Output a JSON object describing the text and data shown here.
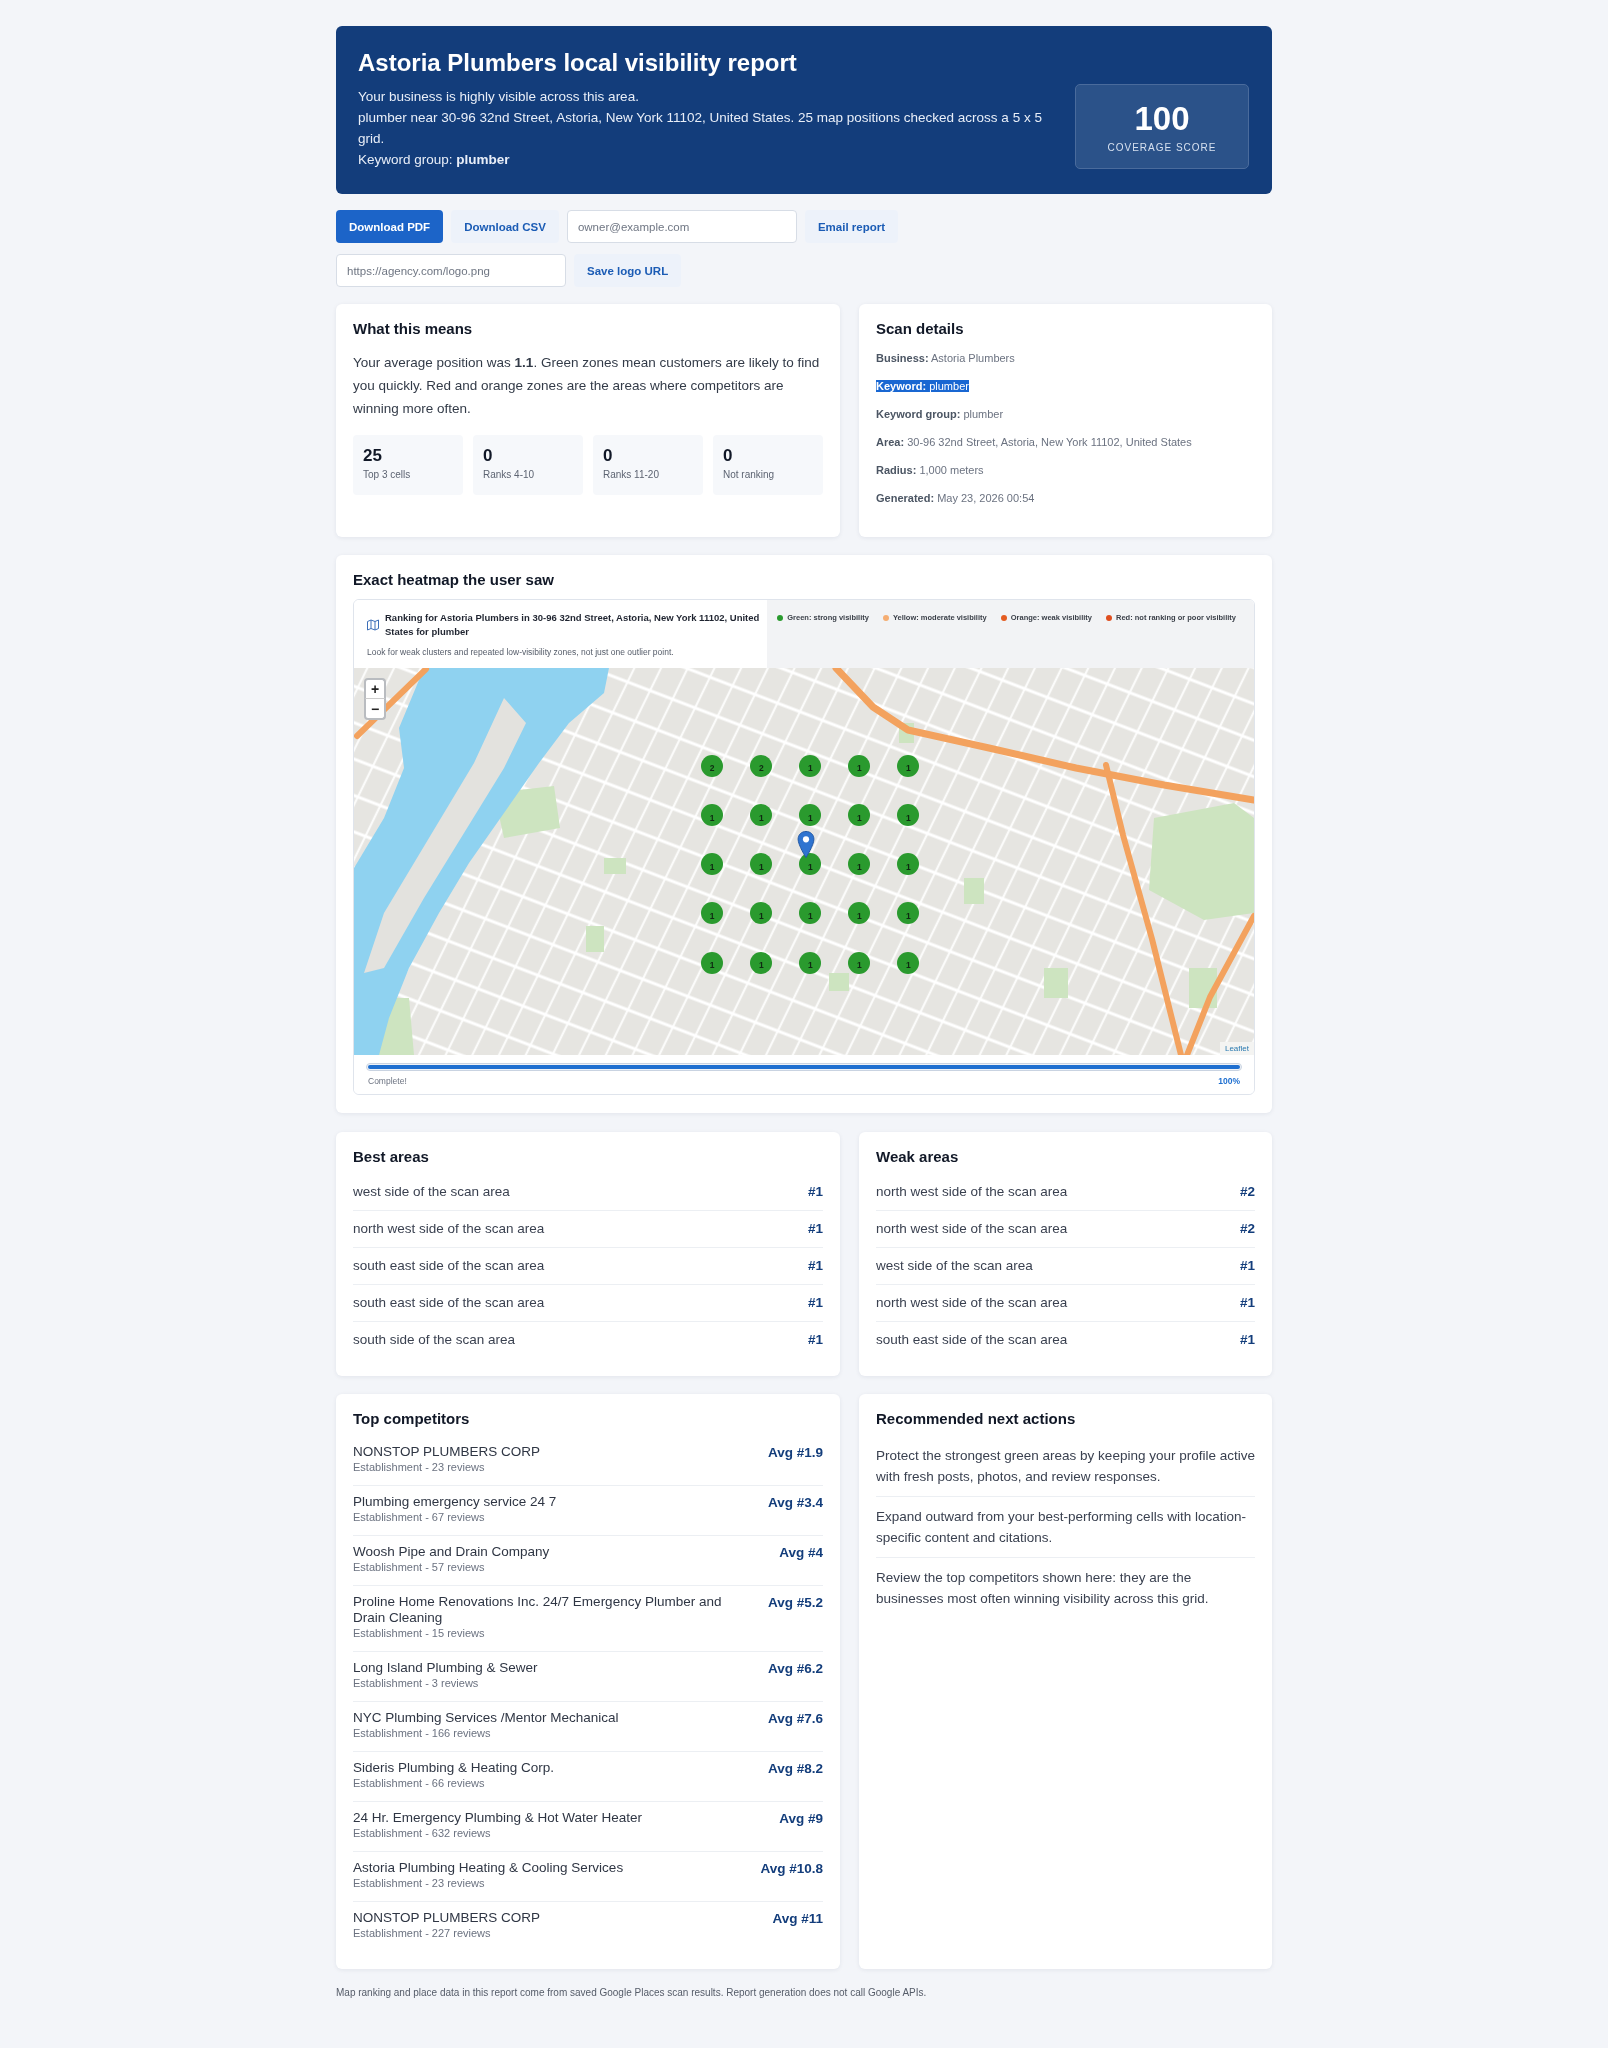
{
  "header": {
    "title": "Astoria Plumbers local visibility report",
    "summary": "Your business is highly visible across this area.",
    "scope": "plumber near 30-96 32nd Street, Astoria, New York 11102, United States. 25 map positions checked across a 5 x 5 grid.",
    "keyword_group": "Keyword group: **plumber**",
    "score": "100",
    "score_label": "COVERAGE SCORE"
  },
  "export_rows": [
    [
      {
        "kind": "button",
        "label": "Download PDF",
        "primary": true
      },
      {
        "kind": "button",
        "label": "Download CSV",
        "primary": false
      },
      {
        "kind": "input",
        "placeholder": "owner@example.com"
      },
      {
        "kind": "button",
        "label": "Email report",
        "primary": false
      }
    ],
    [
      {
        "kind": "input",
        "placeholder": "https://agency.com/logo.png"
      },
      {
        "kind": "button",
        "label": "Save logo URL",
        "primary": false
      }
    ]
  ],
  "what_this_means": {
    "title": "What this means",
    "text": "Your average position was **1.1**. Green zones mean customers are likely to find you quickly. Red and orange zones are the areas where competitors are winning more often.",
    "stats": [
      {
        "value": "25",
        "label": "Top 3 cells"
      },
      {
        "value": "0",
        "label": "Ranks 4-10"
      },
      {
        "value": "0",
        "label": "Ranks 11-20"
      },
      {
        "value": "0",
        "label": "Not ranking"
      }
    ]
  },
  "scan_details": {
    "title": "Scan details",
    "items": [
      {
        "text": "**Business:** Astoria Plumbers",
        "highlighted": false
      },
      {
        "text": "**Keyword:** plumber",
        "highlighted": true
      },
      {
        "text": "**Keyword group:** plumber",
        "highlighted": false
      },
      {
        "text": "**Area:** 30-96 32nd Street, Astoria, New York 11102, United States",
        "highlighted": false
      },
      {
        "text": "**Radius:** 1,000 meters",
        "highlighted": false
      },
      {
        "text": "**Generated:** May 23, 2026 00:54",
        "highlighted": false
      }
    ]
  },
  "heatmap": {
    "title": "Exact heatmap the user saw",
    "map_title": "Ranking for Astoria Plumbers in 30-96 32nd Street, Astoria, New York 11102, United States for plumber",
    "map_note": "Look for weak clusters and repeated low-visibility zones, not just one outlier point.",
    "legend": [
      {
        "label": "Green: strong visibility",
        "color": "#2a9a2e"
      },
      {
        "label": "Yellow: moderate visibility",
        "color": "#f5ad72"
      },
      {
        "label": "Orange: weak visibility",
        "color": "#e45c20"
      },
      {
        "label": "Red: not ranking or poor visibility",
        "color": "#df4e1f"
      }
    ],
    "zoom_controls": [
      "+",
      "−"
    ],
    "marker_rows": [
      [
        {
          "rank": "2",
          "color": "#2a9a2e"
        },
        {
          "rank": "2",
          "color": "#2a9a2e"
        },
        {
          "rank": "1",
          "color": "#2a9a2e"
        },
        {
          "rank": "1",
          "color": "#2a9a2e"
        },
        {
          "rank": "1",
          "color": "#2a9a2e"
        }
      ],
      [
        {
          "rank": "1",
          "color": "#2a9a2e"
        },
        {
          "rank": "1",
          "color": "#2a9a2e"
        },
        {
          "rank": "1",
          "color": "#2a9a2e"
        },
        {
          "rank": "1",
          "color": "#2a9a2e"
        },
        {
          "rank": "1",
          "color": "#2a9a2e"
        }
      ],
      [
        {
          "rank": "1",
          "color": "#2a9a2e"
        },
        {
          "rank": "1",
          "color": "#2a9a2e"
        },
        {
          "rank": "1",
          "color": "#2a9a2e"
        },
        {
          "rank": "1",
          "color": "#2a9a2e"
        },
        {
          "rank": "1",
          "color": "#2a9a2e"
        }
      ],
      [
        {
          "rank": "1",
          "color": "#2a9a2e"
        },
        {
          "rank": "1",
          "color": "#2a9a2e"
        },
        {
          "rank": "1",
          "color": "#2a9a2e"
        },
        {
          "rank": "1",
          "color": "#2a9a2e"
        },
        {
          "rank": "1",
          "color": "#2a9a2e"
        }
      ],
      [
        {
          "rank": "1",
          "color": "#2a9a2e"
        },
        {
          "rank": "1",
          "color": "#2a9a2e"
        },
        {
          "rank": "1",
          "color": "#2a9a2e"
        },
        {
          "rank": "1",
          "color": "#2a9a2e"
        },
        {
          "rank": "1",
          "color": "#2a9a2e"
        }
      ]
    ],
    "attribution": "Leaflet",
    "progress": {
      "label": "Complete!",
      "reading": "100%",
      "level": 1
    }
  },
  "best_areas": {
    "title": "Best areas",
    "rows": [
      {
        "area": "west side of the scan area",
        "rank": "#1"
      },
      {
        "area": "north west side of the scan area",
        "rank": "#1"
      },
      {
        "area": "south east side of the scan area",
        "rank": "#1"
      },
      {
        "area": "south east side of the scan area",
        "rank": "#1"
      },
      {
        "area": "south side of the scan area",
        "rank": "#1"
      }
    ]
  },
  "weak_areas": {
    "title": "Weak areas",
    "rows": [
      {
        "area": "north west side of the scan area",
        "rank": "#2"
      },
      {
        "area": "north west side of the scan area",
        "rank": "#2"
      },
      {
        "area": "west side of the scan area",
        "rank": "#1"
      },
      {
        "area": "north west side of the scan area",
        "rank": "#1"
      },
      {
        "area": "south east side of the scan area",
        "rank": "#1"
      }
    ]
  },
  "competitors": {
    "title": "Top competitors",
    "rows": [
      {
        "name": "NONSTOP PLUMBERS CORP",
        "detail": "Establishment - 23 reviews",
        "average": "Avg #1.9"
      },
      {
        "name": "Plumbing emergency service 24 7",
        "detail": "Establishment - 67 reviews",
        "average": "Avg #3.4"
      },
      {
        "name": "Woosh Pipe and Drain Company",
        "detail": "Establishment - 57 reviews",
        "average": "Avg #4"
      },
      {
        "name": "Proline Home Renovations Inc. 24/7 Emergency Plumber and Drain Cleaning",
        "detail": "Establishment - 15 reviews",
        "average": "Avg #5.2"
      },
      {
        "name": "Long Island Plumbing & Sewer",
        "detail": "Establishment - 3 reviews",
        "average": "Avg #6.2"
      },
      {
        "name": "NYC Plumbing Services /Mentor Mechanical",
        "detail": "Establishment - 166 reviews",
        "average": "Avg #7.6"
      },
      {
        "name": "Sideris Plumbing & Heating Corp.",
        "detail": "Establishment - 66 reviews",
        "average": "Avg #8.2"
      },
      {
        "name": "24 Hr. Emergency Plumbing & Hot Water Heater",
        "detail": "Establishment - 632 reviews",
        "average": "Avg #9"
      },
      {
        "name": "Astoria Plumbing Heating & Cooling Services",
        "detail": "Establishment - 23 reviews",
        "average": "Avg #10.8"
      },
      {
        "name": "NONSTOP PLUMBERS CORP",
        "detail": "Establishment - 227 reviews",
        "average": "Avg #11"
      }
    ]
  },
  "next_actions": {
    "title": "Recommended next actions",
    "items": [
      "Protect the strongest green areas by keeping your profile active with fresh posts, photos, and review responses.",
      "Expand outward from your best-performing cells with location-specific content and citations.",
      "Review the top competitors shown here: they are the businesses most often winning visibility across this grid."
    ]
  },
  "footer": "Map ranking and place data in this report come from saved Google Places scan results. Report generation does not call Google APIs."
}
